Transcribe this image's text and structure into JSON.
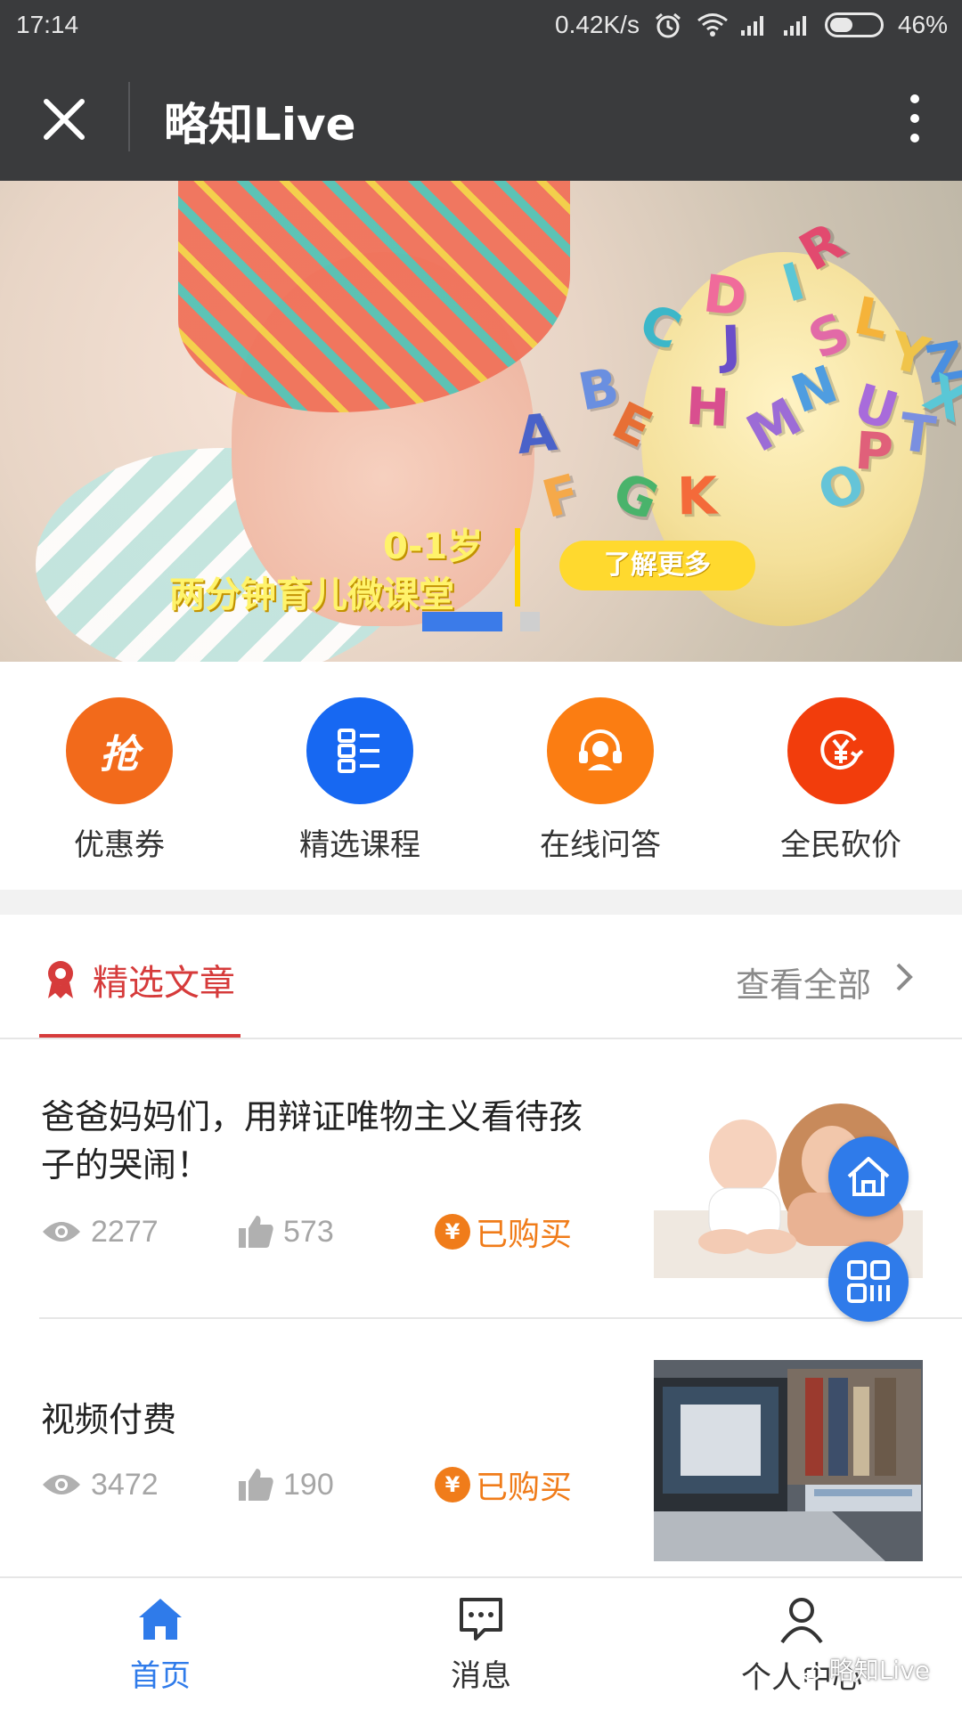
{
  "status_bar": {
    "time": "17:14",
    "speed": "0.42K/s",
    "battery": "46%",
    "battery_level": 0.46
  },
  "title_bar": {
    "title": "略知Live"
  },
  "banner": {
    "age": "0-1岁",
    "caption": "两分钟育儿微课堂",
    "cta": "了解更多",
    "letters": [
      "R",
      "D",
      "I",
      "C",
      "J",
      "S",
      "L",
      "B",
      "E",
      "H",
      "N",
      "U",
      "A",
      "M",
      "T",
      "F",
      "G",
      "K",
      "O",
      "Y",
      "Z",
      "X",
      "P"
    ],
    "slides": 2,
    "active_slide": 1
  },
  "quick_menu": [
    {
      "label": "优惠券",
      "icon": "grab-coupon-icon",
      "icon_text": "抢",
      "color": "#f26a1b"
    },
    {
      "label": "精选课程",
      "icon": "course-list-icon",
      "color": "#1768f2"
    },
    {
      "label": "在线问答",
      "icon": "headset-icon",
      "color": "#fb7d12"
    },
    {
      "label": "全民砍价",
      "icon": "price-cut-icon",
      "color": "#f23d0c"
    }
  ],
  "articles_section": {
    "title": "精选文章",
    "view_all": "查看全部"
  },
  "articles": [
    {
      "title": "爸爸妈妈们，用辩证唯物主义看待孩子的哭闹！",
      "views": "2277",
      "likes": "573",
      "status": "已购买"
    },
    {
      "title": "视频付费",
      "views": "3472",
      "likes": "190",
      "status": "已购买"
    }
  ],
  "bottom_nav": [
    {
      "label": "首页",
      "icon": "home-icon",
      "active": true
    },
    {
      "label": "消息",
      "icon": "message-icon",
      "active": false
    },
    {
      "label": "个人中心",
      "icon": "user-icon",
      "active": false
    }
  ],
  "watermark": "略知Live",
  "colors": {
    "accent": "#2f7bea",
    "red": "#d63b3b",
    "orange": "#f07c1a",
    "dark_header": "#3a3b3d"
  }
}
